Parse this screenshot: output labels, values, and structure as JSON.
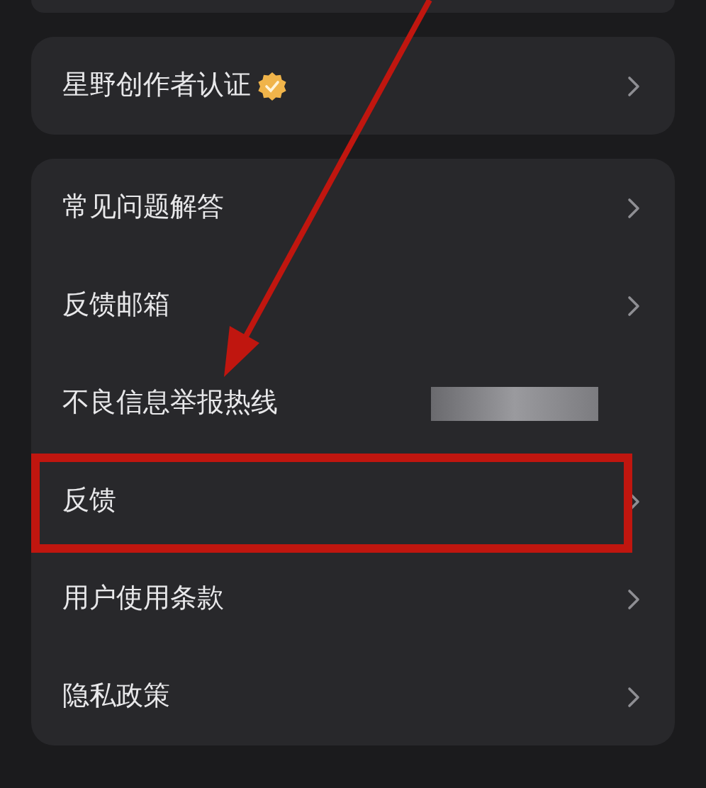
{
  "cards": [
    {
      "rows": [
        {
          "label": "星野创作者认证",
          "kind": "link",
          "verified": true,
          "highlighted": false
        }
      ]
    },
    {
      "rows": [
        {
          "label": "常见问题解答",
          "kind": "link",
          "verified": false,
          "highlighted": false
        },
        {
          "label": "反馈邮箱",
          "kind": "link",
          "verified": false,
          "highlighted": false
        },
        {
          "label": "不良信息举报热线",
          "kind": "redacted",
          "verified": false,
          "highlighted": false
        },
        {
          "label": "反馈",
          "kind": "link",
          "verified": false,
          "highlighted": true
        },
        {
          "label": "用户使用条款",
          "kind": "link",
          "verified": false,
          "highlighted": false
        },
        {
          "label": "隐私政策",
          "kind": "link",
          "verified": false,
          "highlighted": false
        }
      ]
    }
  ]
}
